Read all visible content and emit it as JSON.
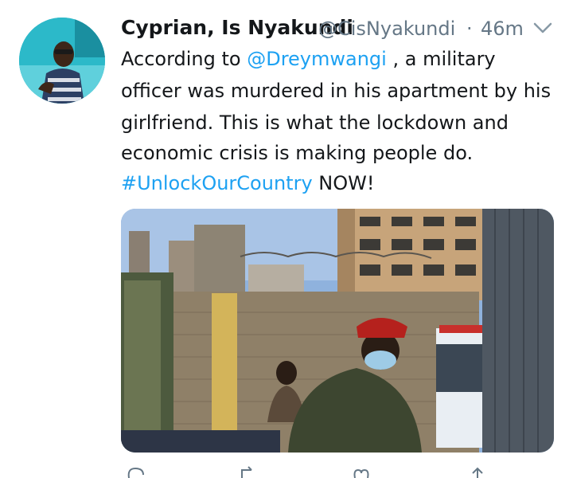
{
  "tweet": {
    "display_name": "Cyprian, Is Nyakundi",
    "handle": "@CisNyakundi",
    "separator": "·",
    "time": "46m",
    "text": {
      "line1_prefix": "According to ",
      "line1_mention": "@Dreymwangi",
      "line1_suffix": " , a military",
      "line2": "officer was murdered in his apartment by his",
      "line3": "girlfriend. This is what the lockdown and",
      "line4": "economic crisis is making people do.",
      "line5_hashtag": "#UnlockOurCountry",
      "line5_suffix": " NOW!"
    }
  },
  "colors": {
    "link": "#1da1f2",
    "secondary_text": "#657786",
    "primary_text": "#14171a"
  },
  "icons": {
    "more": "chevron-down-icon",
    "reply": "reply-icon",
    "retweet": "retweet-icon",
    "like": "heart-icon",
    "share": "share-icon"
  }
}
